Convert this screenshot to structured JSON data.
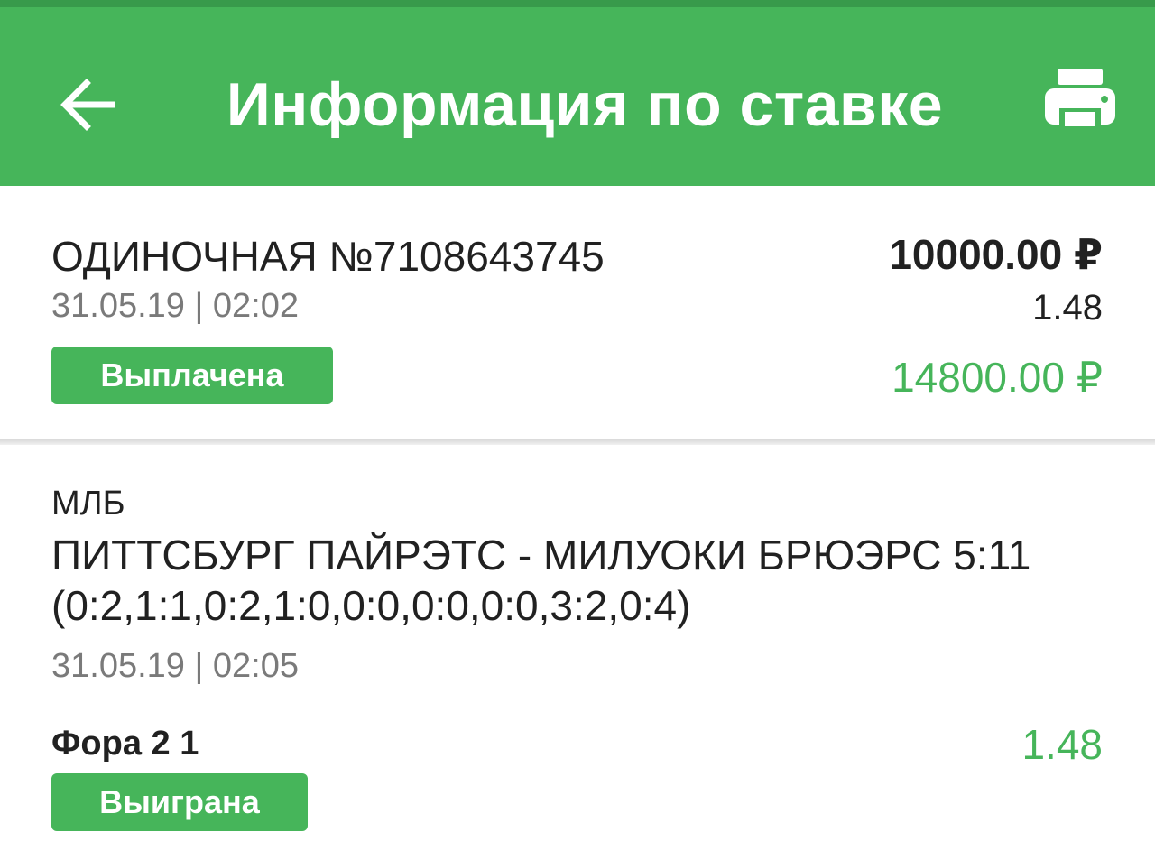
{
  "colors": {
    "accent": "#46b55a",
    "status_bar": "#389a4b",
    "text_primary": "#212121",
    "text_secondary": "#7a7a7a",
    "background": "#f1f1f1"
  },
  "header": {
    "title": "Информация по ставке",
    "back_icon": "arrow-left-icon",
    "print_icon": "printer-icon"
  },
  "bet": {
    "title": "ОДИНОЧНАЯ №7108643745",
    "datetime": "31.05.19 | 02:02",
    "status": "Выплачена",
    "stake": "10000.00 ₽",
    "odds": "1.48",
    "payout": "14800.00 ₽"
  },
  "event": {
    "league": "МЛБ",
    "name": "ПИТТСБУРГ ПАЙРЭТС - МИЛУОКИ БРЮЭРС 5:11 (0:2,1:1,0:2,1:0,0:0,0:0,0:0,3:2,0:4)",
    "datetime": "31.05.19 | 02:05",
    "market": "Фора 2 1",
    "odds": "1.48",
    "status": "Выиграна"
  }
}
